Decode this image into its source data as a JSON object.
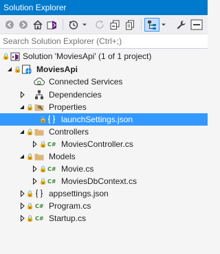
{
  "window": {
    "title": "Solution Explorer"
  },
  "toolbar": {
    "buttons": [
      "back-icon",
      "forward-icon",
      "home-icon",
      "vs-switch-views-icon",
      "history-icon",
      "dropdown-arrow-icon",
      "refresh-icon",
      "collapse-all-icon",
      "show-all-files-icon",
      "tree-view-icon",
      "dropdown-arrow-icon",
      "wrench-icon",
      "preview-icon"
    ]
  },
  "search": {
    "placeholder": "Search Solution Explorer (Ctrl+;)"
  },
  "tree": {
    "solution": "Solution 'MoviesApi' (1 of 1 project)",
    "project": "MoviesApi",
    "connected_services": "Connected Services",
    "dependencies": "Dependencies",
    "properties": "Properties",
    "launch_settings": "launchSettings.json",
    "controllers": "Controllers",
    "movies_controller": "MoviesController.cs",
    "models": "Models",
    "movie": "Movie.cs",
    "movies_db_context": "MoviesDbContext.cs",
    "appsettings": "appsettings.json",
    "program": "Program.cs",
    "startup": "Startup.cs",
    "csharp_glyph": "C#",
    "lock_glyph": "🔒"
  },
  "colors": {
    "title_bar": "#007acc",
    "selection": "#3399ff",
    "folder": "#dcb67a",
    "csharp": "#388a34"
  }
}
